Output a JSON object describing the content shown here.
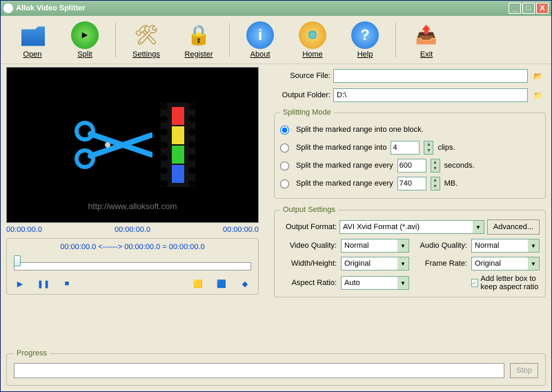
{
  "window": {
    "title": "Allok Video Splitter"
  },
  "toolbar": {
    "open": "Open",
    "split": "Split",
    "settings": "Settings",
    "register": "Register",
    "about": "About",
    "home": "Home",
    "help": "Help",
    "exit": "Exit"
  },
  "preview": {
    "watermark": "http://www.alloksoft.com",
    "time_start": "00:00:00.0",
    "time_mid": "00:00:00.0",
    "time_end": "00:00:00.0",
    "range_text": "00:00:00.0 <------> 00:00:00.0 = 00:00:00.0"
  },
  "source": {
    "label": "Source File:",
    "value": ""
  },
  "output": {
    "label": "Output Folder:",
    "value": "D:\\"
  },
  "splitting": {
    "legend": "Splitting Mode",
    "opt1": "Split the marked range into one block.",
    "opt2_prefix": "Split the marked range into",
    "opt2_value": "4",
    "opt2_suffix": "clips.",
    "opt3_prefix": "Split the marked range every",
    "opt3_value": "600",
    "opt3_suffix": "seconds.",
    "opt4_prefix": "Split the marked range every",
    "opt4_value": "740",
    "opt4_suffix": "MB."
  },
  "outset": {
    "legend": "Output Settings",
    "format_label": "Output Format:",
    "format_value": "AVI Xvid Format (*.avi)",
    "advanced": "Advanced...",
    "vq_label": "Video Quality:",
    "vq_value": "Normal",
    "aq_label": "Audio Quality:",
    "aq_value": "Normal",
    "wh_label": "Width/Height:",
    "wh_value": "Original",
    "fr_label": "Frame Rate:",
    "fr_value": "Original",
    "ar_label": "Aspect Ratio:",
    "ar_value": "Auto",
    "letterbox": "Add letter box to keep aspect ratio"
  },
  "progress": {
    "legend": "Progress",
    "stop": "Stop"
  }
}
